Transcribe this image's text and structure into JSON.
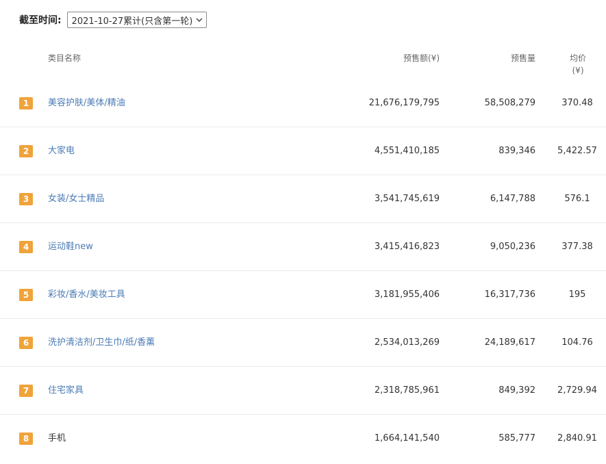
{
  "filter": {
    "label": "截至时间:",
    "selected": "2021-10-27累计(只含第一轮)",
    "icon": "chevron-down-icon"
  },
  "table": {
    "headers": {
      "name": "类目名称",
      "amount": "预售额(¥)",
      "qty": "预售量",
      "avg_line1": "均价",
      "avg_line2": "(¥)"
    },
    "rank_color": "#f0a33a",
    "link_color": "#4a7bb5",
    "rows": [
      {
        "rank": "1",
        "name": "美容护肤/美体/精油",
        "amount": "21,676,179,795",
        "qty": "58,508,279",
        "avg": "370.48",
        "link": true
      },
      {
        "rank": "2",
        "name": "大家电",
        "amount": "4,551,410,185",
        "qty": "839,346",
        "avg": "5,422.57",
        "link": true
      },
      {
        "rank": "3",
        "name": "女装/女士精品",
        "amount": "3,541,745,619",
        "qty": "6,147,788",
        "avg": "576.1",
        "link": true
      },
      {
        "rank": "4",
        "name": "运动鞋new",
        "amount": "3,415,416,823",
        "qty": "9,050,236",
        "avg": "377.38",
        "link": true
      },
      {
        "rank": "5",
        "name": "彩妆/香水/美妆工具",
        "amount": "3,181,955,406",
        "qty": "16,317,736",
        "avg": "195",
        "link": true
      },
      {
        "rank": "6",
        "name": "洗护清洁剂/卫生巾/纸/香薰",
        "amount": "2,534,013,269",
        "qty": "24,189,617",
        "avg": "104.76",
        "link": true
      },
      {
        "rank": "7",
        "name": "住宅家具",
        "amount": "2,318,785,961",
        "qty": "849,392",
        "avg": "2,729.94",
        "link": true
      },
      {
        "rank": "8",
        "name": "手机",
        "amount": "1,664,141,540",
        "qty": "585,777",
        "avg": "2,840.91",
        "link": false
      }
    ]
  }
}
